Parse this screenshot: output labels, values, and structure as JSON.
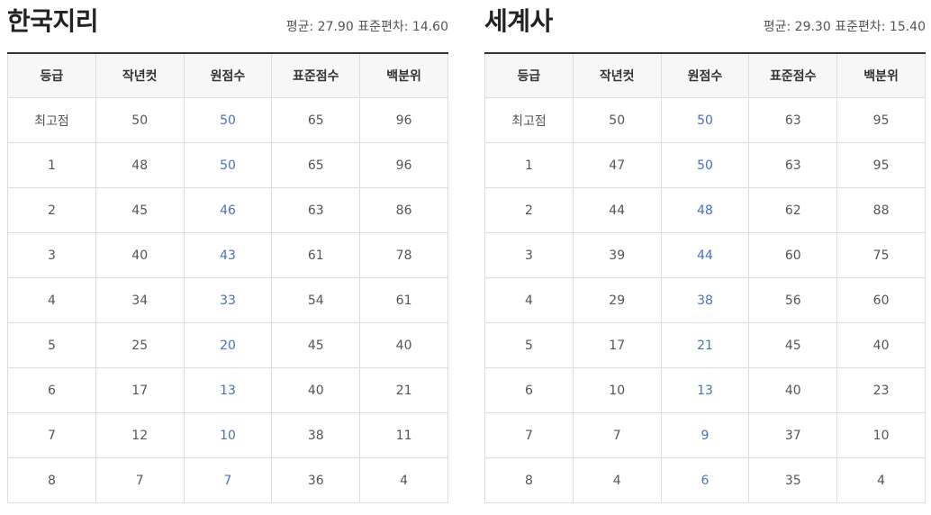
{
  "tables": [
    {
      "subject": "한국지리",
      "mean_label": "평균:",
      "mean": "27.90",
      "sd_label": "표준편차:",
      "sd": "14.60",
      "headers": [
        "등급",
        "작년컷",
        "원점수",
        "표준점수",
        "백분위"
      ],
      "rows": [
        [
          "최고점",
          "50",
          "50",
          "65",
          "96"
        ],
        [
          "1",
          "48",
          "50",
          "65",
          "96"
        ],
        [
          "2",
          "45",
          "46",
          "63",
          "86"
        ],
        [
          "3",
          "40",
          "43",
          "61",
          "78"
        ],
        [
          "4",
          "34",
          "33",
          "54",
          "61"
        ],
        [
          "5",
          "25",
          "20",
          "45",
          "40"
        ],
        [
          "6",
          "17",
          "13",
          "40",
          "21"
        ],
        [
          "7",
          "12",
          "10",
          "38",
          "11"
        ],
        [
          "8",
          "7",
          "7",
          "36",
          "4"
        ]
      ]
    },
    {
      "subject": "세계사",
      "mean_label": "평균:",
      "mean": "29.30",
      "sd_label": "표준편차:",
      "sd": "15.40",
      "headers": [
        "등급",
        "작년컷",
        "원점수",
        "표준점수",
        "백분위"
      ],
      "rows": [
        [
          "최고점",
          "50",
          "50",
          "63",
          "95"
        ],
        [
          "1",
          "47",
          "50",
          "63",
          "95"
        ],
        [
          "2",
          "44",
          "48",
          "62",
          "88"
        ],
        [
          "3",
          "39",
          "44",
          "60",
          "75"
        ],
        [
          "4",
          "29",
          "38",
          "56",
          "60"
        ],
        [
          "5",
          "17",
          "21",
          "45",
          "40"
        ],
        [
          "6",
          "10",
          "13",
          "40",
          "23"
        ],
        [
          "7",
          "7",
          "9",
          "37",
          "10"
        ],
        [
          "8",
          "4",
          "6",
          "35",
          "4"
        ]
      ]
    }
  ],
  "colors": {
    "raw_score_text": "#4a6fc1",
    "header_background": "#f7f7f7",
    "border": "#dddddd",
    "top_border": "#333333"
  }
}
